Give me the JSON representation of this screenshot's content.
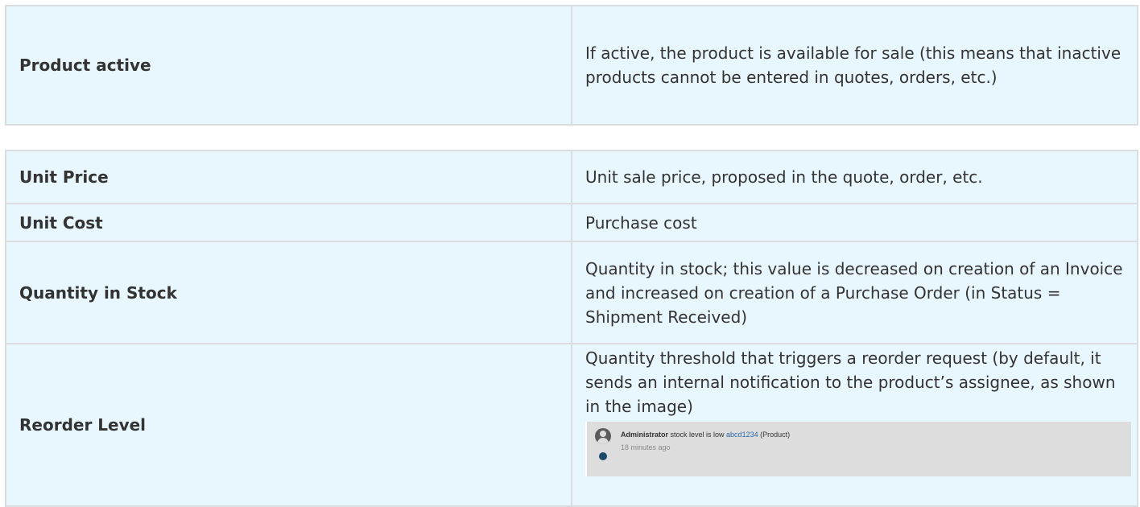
{
  "table1": {
    "rows": [
      {
        "label": "Product active",
        "description": "If active, the product is available for sale (this means that inactive products cannot be entered in quotes, orders, etc.)"
      }
    ]
  },
  "table2": {
    "rows": [
      {
        "label": "Unit Price",
        "description": "Unit sale price, proposed in the quote, order, etc."
      },
      {
        "label": "Unit Cost",
        "description": "Purchase cost"
      },
      {
        "label": "Quantity in Stock",
        "description": "Quantity in stock; this value is decreased on creation of an Invoice and increased on creation of a Purchase Order (in Status = Shipment Received)"
      },
      {
        "label": "Reorder Level",
        "description": "Quantity threshold that triggers a reorder request (by default, it sends an internal notification to the product’s assignee, as shown in the image)"
      }
    ]
  },
  "notification": {
    "user": "Administrator",
    "message": " stock level is low ",
    "product_link": "abcd1234",
    "product_suffix": " (Product)",
    "time": "18 minutes ago"
  }
}
